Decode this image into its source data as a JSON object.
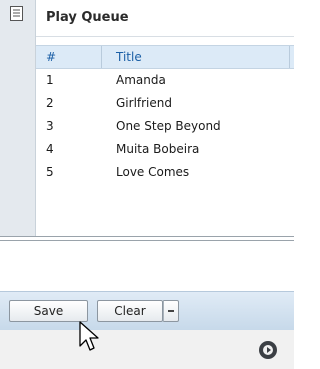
{
  "queue": {
    "title": "Play Queue",
    "columns": {
      "number": "#",
      "title": "Title"
    },
    "rows": [
      {
        "num": "1",
        "title": "Amanda"
      },
      {
        "num": "2",
        "title": "Girlfriend"
      },
      {
        "num": "3",
        "title": "One Step Beyond"
      },
      {
        "num": "4",
        "title": "Muita Bobeira"
      },
      {
        "num": "5",
        "title": "Love Comes"
      }
    ]
  },
  "toolbar": {
    "save_label": "Save",
    "clear_label": "Clear"
  },
  "icons": {
    "panel": "document-icon",
    "dropdown": "dropdown-arrow-icon",
    "logo": "app-logo-icon",
    "cursor": "mouse-cursor-icon"
  },
  "colors": {
    "header_bg": "#dceaf7",
    "header_text": "#1b5fa6",
    "toolbar_bg": "#c7d9ea"
  }
}
